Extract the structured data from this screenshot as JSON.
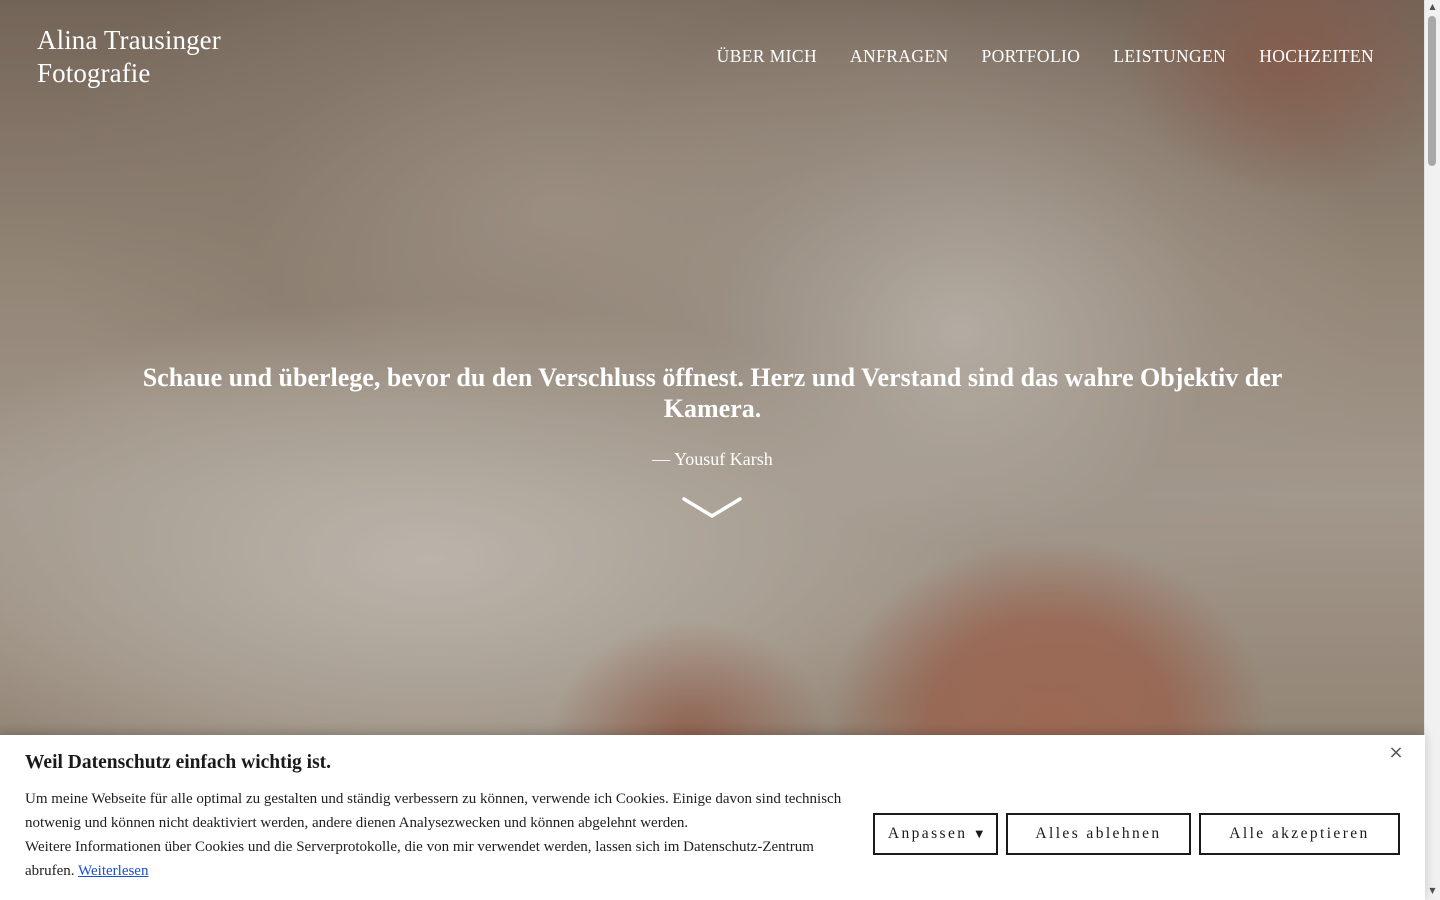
{
  "header": {
    "logo_line1": "Alina Trausinger",
    "logo_line2": "Fotografie",
    "nav": [
      "ÜBER MICH",
      "ANFRAGEN",
      "PORTFOLIO",
      "LEISTUNGEN",
      "HOCHZEITEN"
    ]
  },
  "hero": {
    "quote": "Schaue und überlege, bevor du den Verschluss öffnest. Herz und Verstand sind das wahre Objektiv der Kamera.",
    "author": "— Yousuf Karsh",
    "scroll_icon": "chevron-down-icon"
  },
  "cookie_banner": {
    "title": "Weil Datenschutz einfach wichtig ist.",
    "text_part1": "Um meine Webseite für alle optimal zu gestalten und ständig verbessern zu können, verwende ich Cookies. Einige davon sind technisch notwenig und können nicht deaktiviert werden, andere dienen Analysezwecken und können abgelehnt werden.",
    "text_part2": "Weitere Informationen über Cookies und die Serverprotokolle, die von mir verwendet werden, lassen sich im Datenschutz-Zentrum abrufen.",
    "read_more": "Weiterlesen",
    "close_icon": "close-icon",
    "buttons": {
      "customize": "Anpassen",
      "reject": "Alles ablehnen",
      "accept": "Alle akzeptieren"
    }
  },
  "colors": {
    "text_on_hero": "#ffffff",
    "banner_bg": "#ffffff",
    "button_border": "#1a1a1a",
    "link": "#1a4fd0"
  }
}
